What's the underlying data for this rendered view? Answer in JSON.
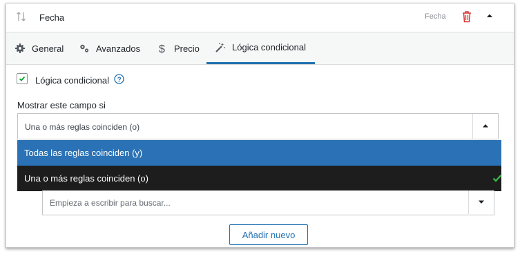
{
  "header": {
    "title": "Fecha",
    "type_label": "Fecha",
    "icons": [
      "sort-icon",
      "trash-icon",
      "collapse-up-icon"
    ],
    "trash_color": "#d63638"
  },
  "tabs": [
    {
      "label": "General",
      "icon": "gear-icon",
      "active": false
    },
    {
      "label": "Avanzados",
      "icon": "gears-icon",
      "active": false
    },
    {
      "label": "Precio",
      "icon": "dollar-icon",
      "active": false
    },
    {
      "label": "Lógica condicional",
      "icon": "magic-wand-icon",
      "active": true
    }
  ],
  "conditional": {
    "checkbox_label": "Lógica condicional",
    "checked": true,
    "check_color": "#00a32a",
    "show_label": "Mostrar este campo si"
  },
  "select": {
    "value": "Una o más reglas coinciden (o)",
    "options": [
      {
        "label": "Todas las reglas coinciden (y)",
        "highlighted": true
      },
      {
        "label": "Una o más reglas coinciden (o)",
        "selected": true
      }
    ]
  },
  "search": {
    "placeholder": "Empieza a escribir para buscar..."
  },
  "add_button": {
    "label": "Añadir nuevo"
  },
  "colors": {
    "accent": "#2271b1",
    "highlight": "#2a72b5",
    "dropdown_dark": "#1d1d1d",
    "selected_check": "#3cb34a"
  }
}
